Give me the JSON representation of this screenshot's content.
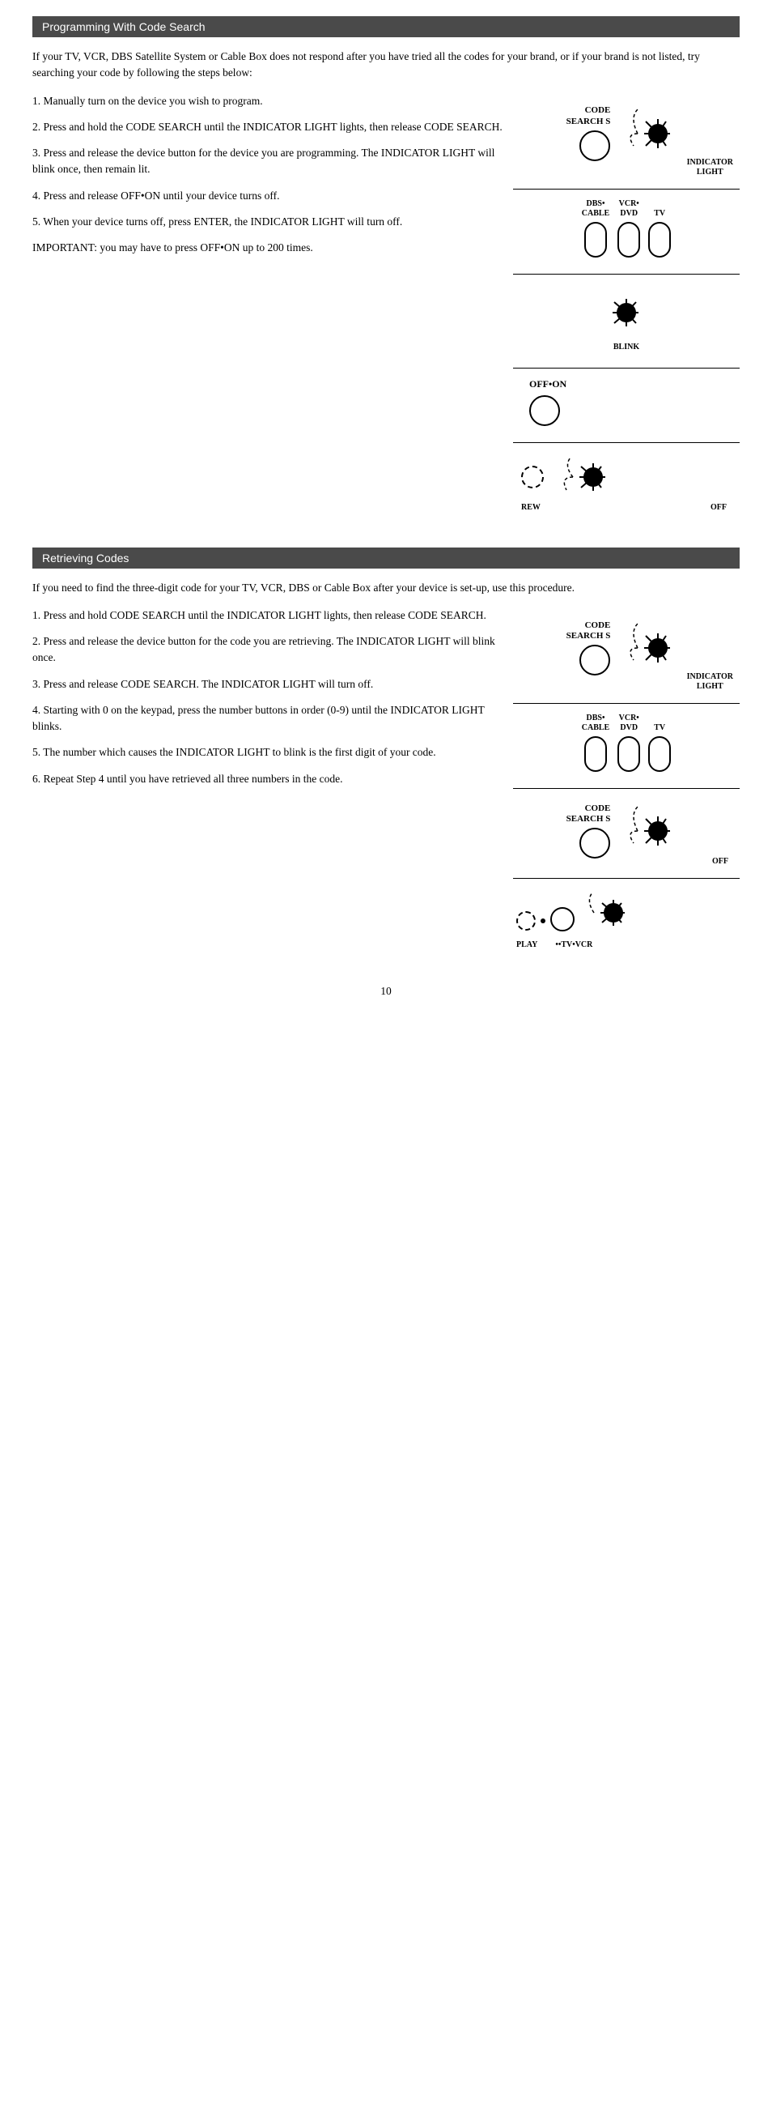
{
  "section1": {
    "header": "Programming With Code Search",
    "intro": "If your TV, VCR, DBS Satellite System or Cable Box  does not respond after you have tried all the codes for your brand, or if your brand is not listed, try searching your code by following the steps below:",
    "steps": [
      "1.   Manually turn on the device you wish to program.",
      "2.   Press and hold the CODE SEARCH until the INDICATOR LIGHT lights, then release CODE SEARCH.",
      "3.   Press and release the device button for the device you are programming. The INDICATOR LIGHT will blink once, then remain lit.",
      "4.   Press and release OFF•ON until your device turns off.",
      "5.   When your device turns off, press ENTER, the INDICATOR LIGHT will turn off.",
      "IMPORTANT: you may have to press OFF•ON up to 200 times."
    ],
    "diagrams": {
      "code_search_label": "CODE\nSEARCH S",
      "indicator_light_label": "INDICATOR\nLIGHT",
      "dbs_cable_label": "DBS•\nCABLE",
      "vcr_dvd_label": "VCR•\nDVD",
      "tv_label": "TV",
      "blink_label": "BLINK",
      "off_on_label": "OFF•ON",
      "rew_label": "REW",
      "off_label": "OFF"
    }
  },
  "section2": {
    "header": "Retrieving Codes",
    "intro": "If you need to find the three-digit code for your TV, VCR, DBS or Cable Box after your device is set-up, use this procedure.",
    "steps": [
      "1.   Press and hold CODE SEARCH until the INDICATOR LIGHT lights, then release CODE SEARCH.",
      "2.   Press and release the device button for the code you are retrieving. The INDICATOR LIGHT will blink once.",
      "3.   Press and release CODE SEARCH. The INDICATOR LIGHT will turn off.",
      "4.   Starting with 0 on the keypad, press the number buttons in order (0-9) until the INDICATOR LIGHT blinks.",
      "5.   The number which causes the INDICATOR LIGHT to blink is the first digit of your code.",
      "6.   Repeat Step 4 until you have retrieved all three numbers in the code."
    ],
    "diagrams": {
      "code_search_label": "CODE\nSEARCH S",
      "indicator_light_label": "INDICATOR\nLIGHT",
      "dbs_cable_label": "DBS•\nCABLE",
      "vcr_dvd_label": "VCR•\nDVD",
      "tv_label": "TV",
      "code_search2_label": "CODE\nSEARCH S",
      "off_label": "OFF",
      "play_label": "PLAY",
      "tv_vcr_label": "••TV•VCR"
    }
  },
  "page_number": "10"
}
